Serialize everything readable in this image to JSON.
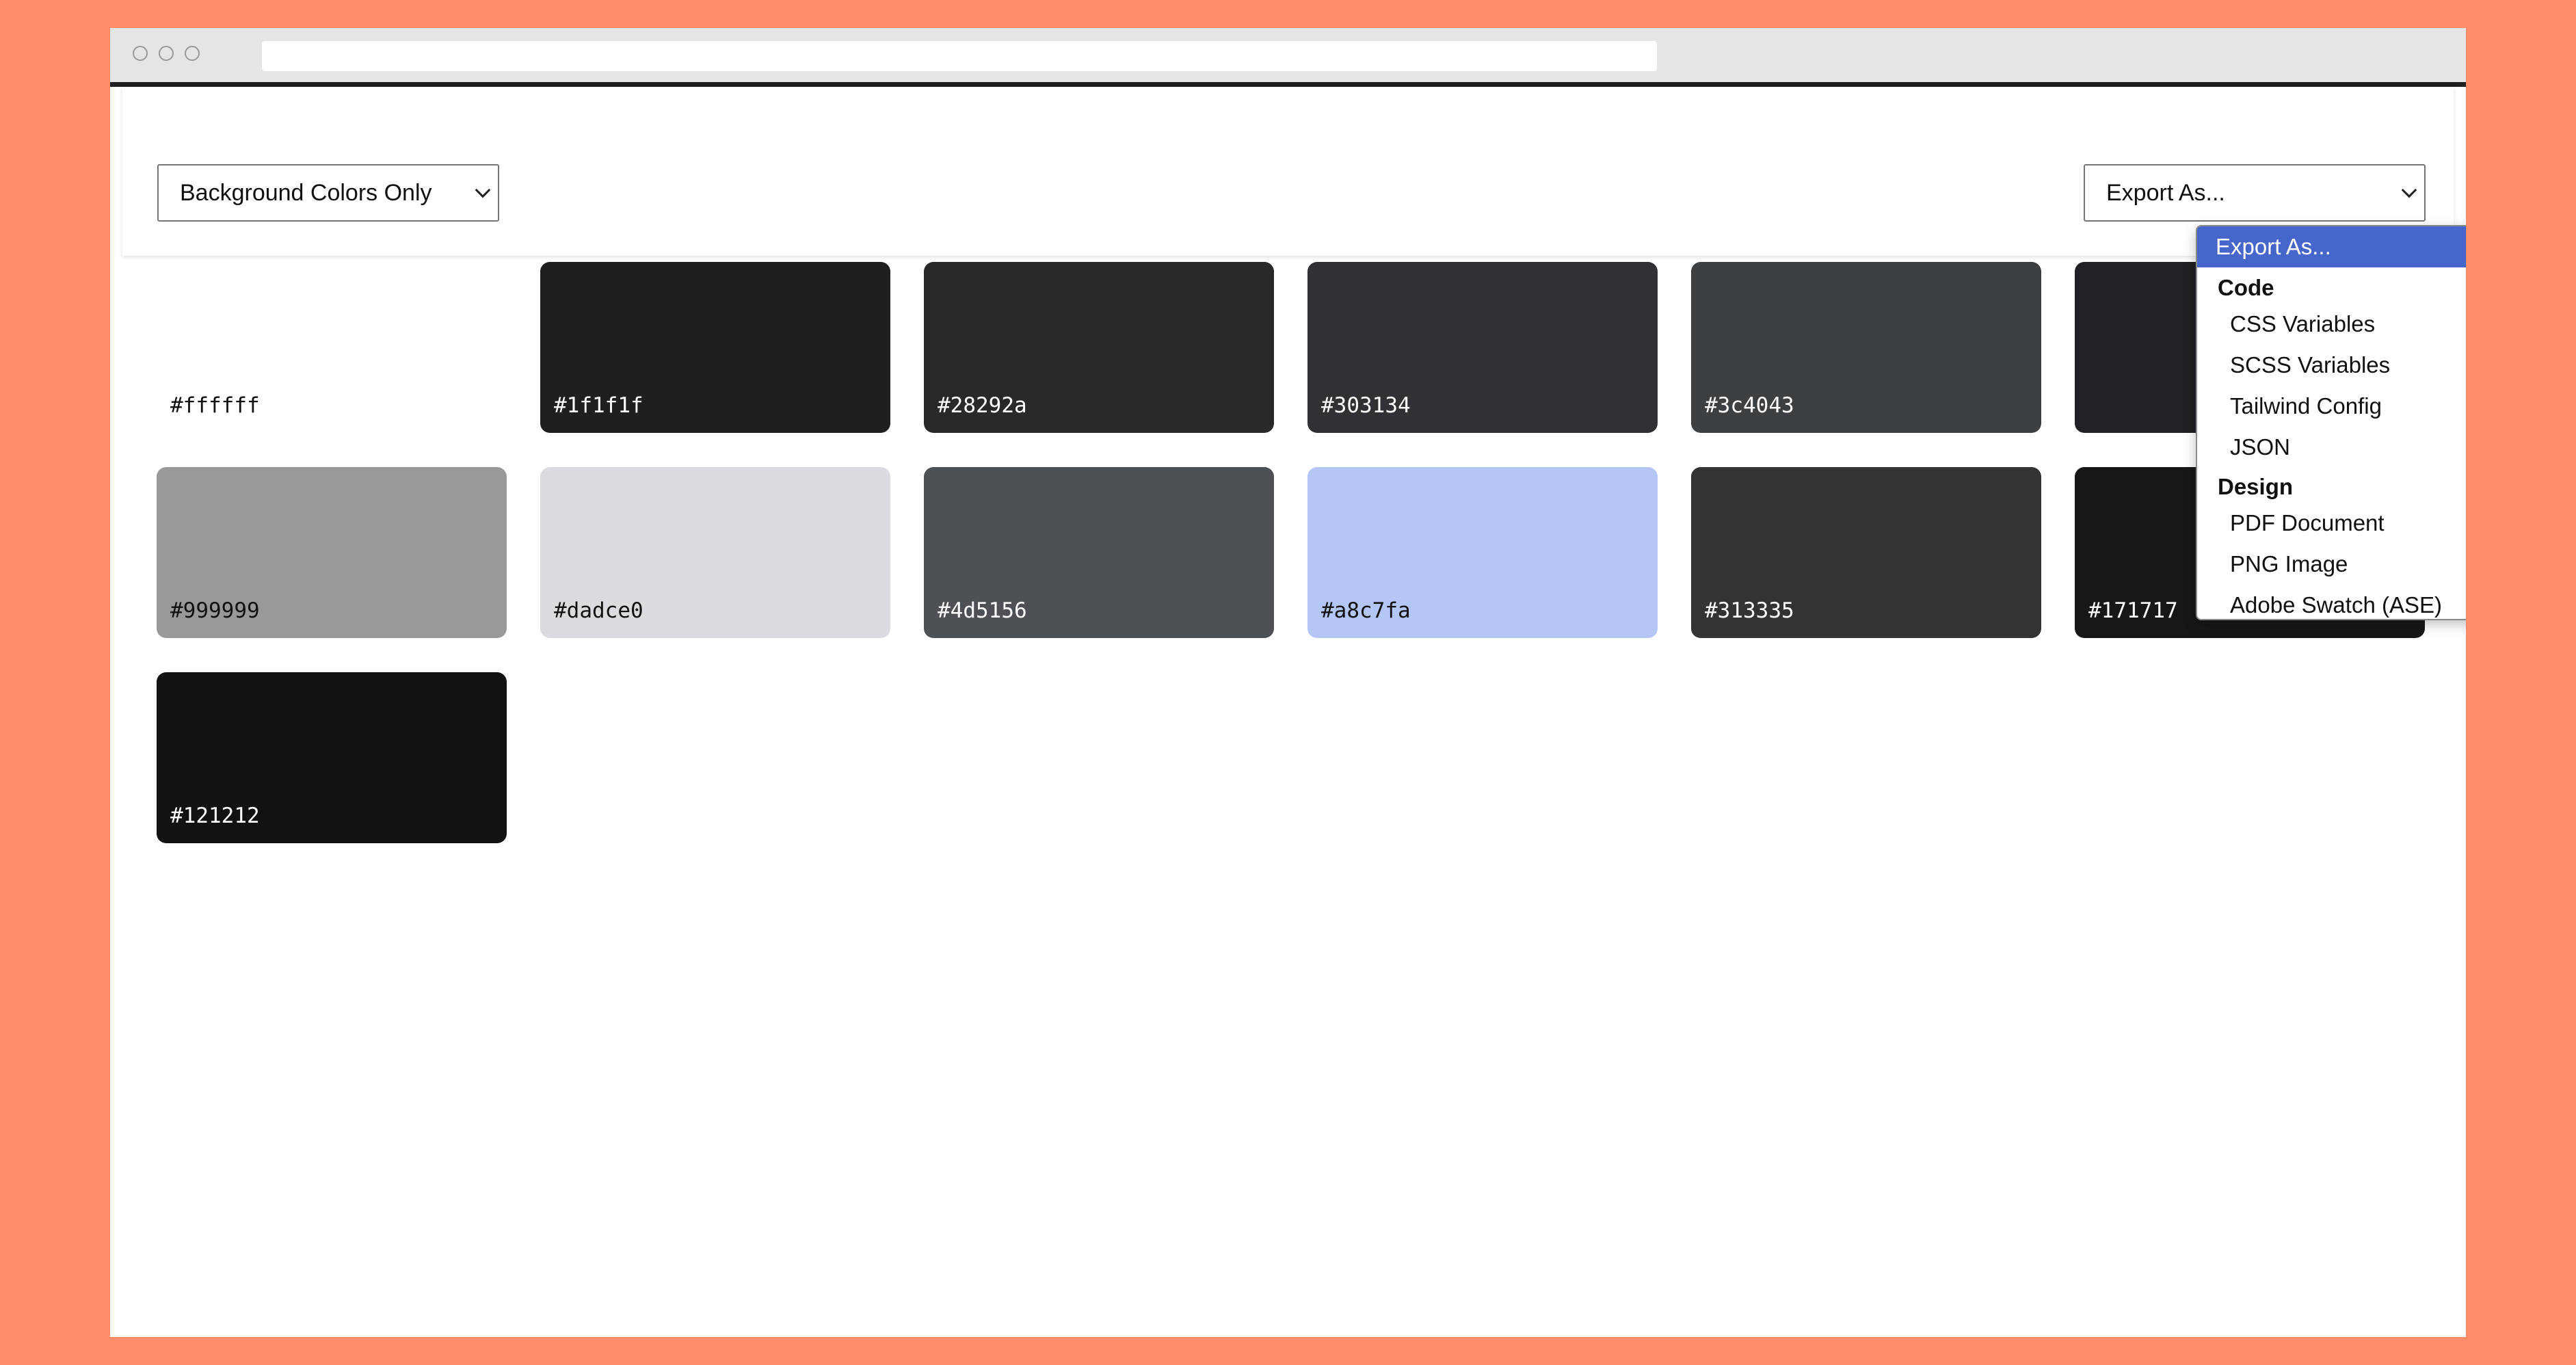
{
  "window": {
    "url": ""
  },
  "filter_select": {
    "value": "Background Colors Only"
  },
  "export_select": {
    "value": "Export As...",
    "menu": {
      "selected": "Export As...",
      "groups": [
        {
          "label": "Code",
          "items": [
            "CSS Variables",
            "SCSS Variables",
            "Tailwind Config",
            "JSON"
          ]
        },
        {
          "label": "Design",
          "items": [
            "PDF Document",
            "PNG Image",
            "Adobe Swatch (ASE)"
          ]
        }
      ]
    }
  },
  "swatches": [
    {
      "hex": "#ffffff",
      "color": "#ffffff",
      "text_color": "#111111"
    },
    {
      "hex": "#1f1f1f",
      "color": "#1f1f1f",
      "text_color": "#ffffff"
    },
    {
      "hex": "#28292a",
      "color": "#28292a",
      "text_color": "#ffffff"
    },
    {
      "hex": "#303134",
      "color": "#303134",
      "text_color": "#ffffff"
    },
    {
      "hex": "#3c4043",
      "color": "#3c4043",
      "text_color": "#ffffff"
    },
    {
      "hex": "",
      "color": "#202124",
      "text_color": "#ffffff"
    },
    {
      "hex": "#999999",
      "color": "#999999",
      "text_color": "#111111"
    },
    {
      "hex": "#dadce0",
      "color": "#dadce0",
      "text_color": "#111111"
    },
    {
      "hex": "#4d5156",
      "color": "#4d5156",
      "text_color": "#ffffff"
    },
    {
      "hex": "#a8c7fa",
      "color": "#b3c6f5",
      "text_color": "#111111"
    },
    {
      "hex": "#313335",
      "color": "#313335",
      "text_color": "#ffffff"
    },
    {
      "hex": "#171717",
      "color": "#171717",
      "text_color": "#ffffff"
    },
    {
      "hex": "#121212",
      "color": "#121212",
      "text_color": "#ffffff"
    }
  ],
  "colors": {
    "page_background": "#ff8c69",
    "titlebar": "#e5e5e5",
    "menu_highlight": "#4766cc"
  }
}
